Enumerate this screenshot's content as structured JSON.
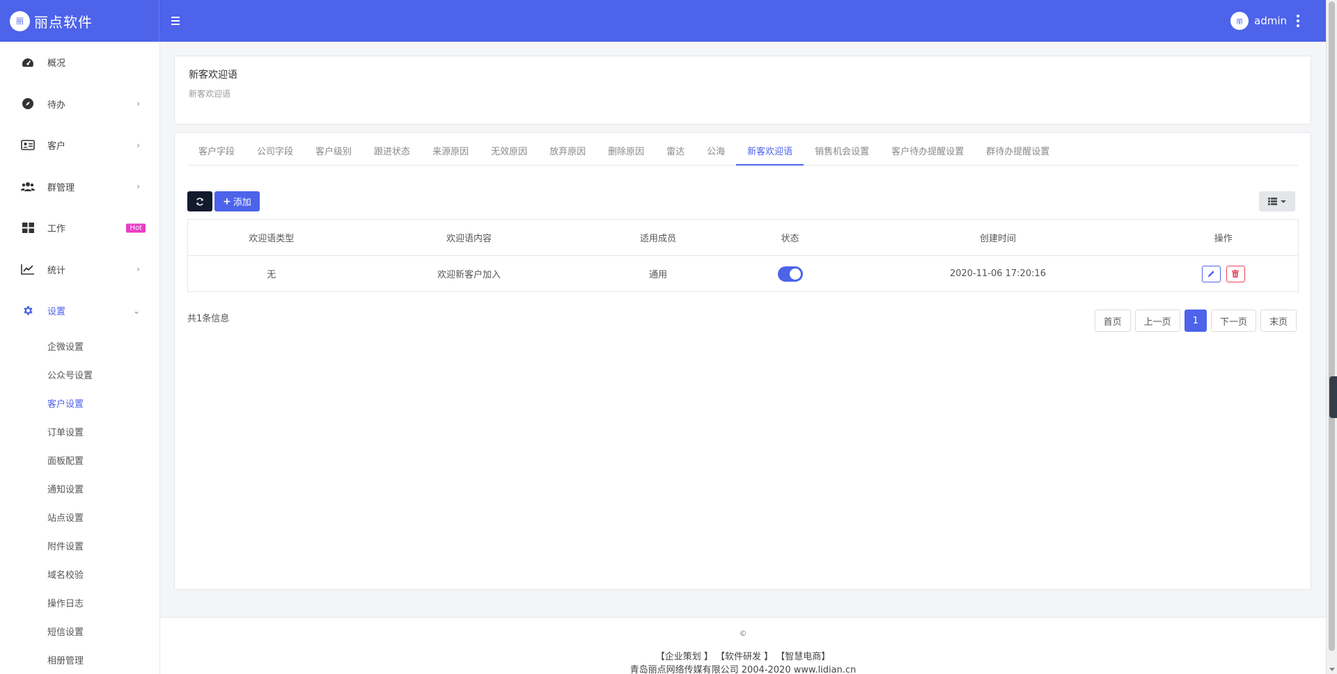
{
  "brand": {
    "logo_text": "丽",
    "name": "丽点软件"
  },
  "user": {
    "avatar_text": "丽",
    "name": "admin"
  },
  "sidebar": {
    "items": [
      {
        "label": "概况",
        "icon": "dashboard-icon"
      },
      {
        "label": "待办",
        "icon": "compass-icon",
        "chevron": "›"
      },
      {
        "label": "客户",
        "icon": "id-card-icon",
        "chevron": "›"
      },
      {
        "label": "群管理",
        "icon": "users-icon",
        "chevron": "›"
      },
      {
        "label": "工作",
        "icon": "grid-icon",
        "badge": "Hot"
      },
      {
        "label": "统计",
        "icon": "chart-line-icon",
        "chevron": "›"
      },
      {
        "label": "设置",
        "icon": "gear-icon",
        "chevron": "⌄"
      }
    ],
    "sub_items": [
      "企微设置",
      "公众号设置",
      "客户设置",
      "订单设置",
      "面板配置",
      "通知设置",
      "站点设置",
      "附件设置",
      "域名校验",
      "操作日志",
      "短信设置",
      "相册管理"
    ]
  },
  "header": {
    "title": "新客欢迎语",
    "subtitle": "新客欢迎语"
  },
  "tabs": [
    "客户字段",
    "公司字段",
    "客户级别",
    "跟进状态",
    "来源原因",
    "无效原因",
    "放弃原因",
    "删除原因",
    "雷达",
    "公海",
    "新客欢迎语",
    "销售机会设置",
    "客户待办提醒设置",
    "群待办提醒设置"
  ],
  "toolbar": {
    "add_label": "添加"
  },
  "table": {
    "columns": [
      "欢迎语类型",
      "欢迎语内容",
      "适用成员",
      "状态",
      "创建时间",
      "操作"
    ],
    "rows": [
      {
        "type": "无",
        "content": "欢迎新客户加入",
        "members": "通用",
        "status_on": true,
        "created": "2020-11-06 17:20:16"
      }
    ]
  },
  "total_text": "共1条信息",
  "pager": {
    "first": "首页",
    "prev": "上一页",
    "current": "1",
    "next": "下一页",
    "last": "末页"
  },
  "footer": {
    "copyright": "©",
    "links": "【企业策划 】 【软件研发 】 【智慧电商】",
    "company": "青岛丽点网络传媒有限公司 2004-2020 www.lidian.cn"
  },
  "colors": {
    "primary": "#4c63ea",
    "dark_button": "#131a2c",
    "danger": "#e8415a",
    "hot_badge": "#e83ec7"
  }
}
